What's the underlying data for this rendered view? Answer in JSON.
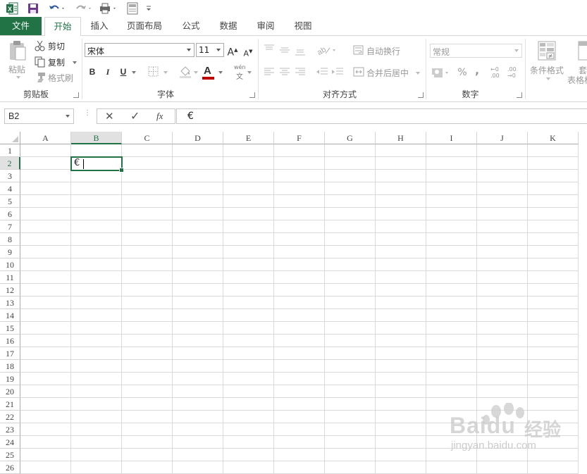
{
  "tabs": {
    "file": "文件",
    "home": "开始",
    "insert": "插入",
    "page_layout": "页面布局",
    "formulas": "公式",
    "data": "数据",
    "review": "审阅",
    "view": "视图"
  },
  "clipboard": {
    "paste": "粘贴",
    "cut": "剪切",
    "copy": "复制",
    "format_painter": "格式刷",
    "group_label": "剪贴板"
  },
  "font": {
    "name": "宋体",
    "size": "11",
    "bold": "B",
    "italic": "I",
    "underline": "U",
    "font_color_letter": "A",
    "phonetic_top": "wén",
    "phonetic_bottom": "文",
    "group_label": "字体"
  },
  "alignment": {
    "wrap_text": "自动换行",
    "merge_center": "合并后居中",
    "group_label": "对齐方式"
  },
  "number": {
    "format": "常规",
    "percent": "%",
    "comma": ",",
    "inc_decimal": "←0 .00",
    "dec_decimal": ".00 →0",
    "group_label": "数字"
  },
  "styles": {
    "conditional_formatting": "条件格式",
    "format_as_table_line1": "套",
    "format_as_table_line2": "表格格"
  },
  "formula_bar": {
    "name_box": "B2",
    "cancel": "✕",
    "enter": "✓",
    "fx": "fx",
    "content": "€"
  },
  "sheet": {
    "columns": [
      "A",
      "B",
      "C",
      "D",
      "E",
      "F",
      "G",
      "H",
      "I",
      "J",
      "K"
    ],
    "rows": [
      "1",
      "2",
      "3",
      "4",
      "5",
      "6",
      "7",
      "8",
      "9",
      "10",
      "11",
      "12",
      "13",
      "14",
      "15",
      "16",
      "17",
      "18",
      "19",
      "20",
      "21",
      "22",
      "23",
      "24",
      "25",
      "26"
    ],
    "selected_column": "B",
    "selected_row": "2",
    "active_cell_value": "€"
  },
  "watermark": {
    "brand": "Baidu",
    "brand_cn": "经验",
    "url": "jingyan.baidu.com"
  },
  "colors": {
    "excel_green": "#217346",
    "font_color_bar": "#c00000"
  }
}
